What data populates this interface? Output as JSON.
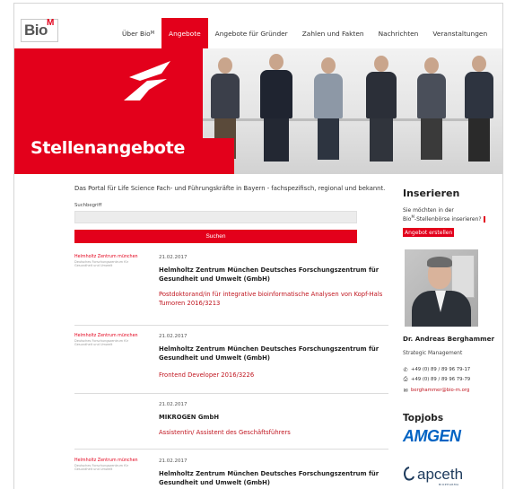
{
  "header": {
    "logo_text": "Bio",
    "logo_super": "M",
    "nav": [
      {
        "label": "Über Bio",
        "sup": "M",
        "active": false
      },
      {
        "label": "Angebote",
        "active": true
      },
      {
        "label": "Angebote für Gründer",
        "active": false
      },
      {
        "label": "Zahlen und Fakten",
        "active": false
      },
      {
        "label": "Nachrichten",
        "active": false
      },
      {
        "label": "Veranstaltungen",
        "active": false
      }
    ]
  },
  "hero": {
    "title": "Stellenangebote"
  },
  "main": {
    "intro": "Das Portal für Life Science Fach- und Führungskräfte in Bayern - fachspezifisch, regional und bekannt.",
    "search_label": "Suchbegriff",
    "search_value": "",
    "search_button": "Suchen",
    "jobs": [
      {
        "logo_name": "Helmholtz Zentrum münchen",
        "logo_sub": "Deutsches Forschungszentrum für Gesundheit und Umwelt",
        "date": "21.02.2017",
        "company": "Helmholtz Zentrum München Deutsches Forschungszentrum für Gesundheit und Umwelt (GmbH)",
        "title": "Postdoktorand/in für integrative bioinformatische Analysen von Kopf-Hals Tumoren 2016/3213"
      },
      {
        "logo_name": "Helmholtz Zentrum münchen",
        "logo_sub": "Deutsches Forschungszentrum für Gesundheit und Umwelt",
        "date": "21.02.2017",
        "company": "Helmholtz Zentrum München Deutsches Forschungszentrum für Gesundheit und Umwelt (GmbH)",
        "title": "Frontend Developer 2016/3226"
      },
      {
        "logo_name": "",
        "logo_sub": "",
        "date": "21.02.2017",
        "company": "MIKROGEN GmbH",
        "title": "Assistentin/ Assistent des Geschäftsführers"
      },
      {
        "logo_name": "Helmholtz Zentrum münchen",
        "logo_sub": "Deutsches Forschungszentrum für Gesundheit und Umwelt",
        "date": "21.02.2017",
        "company": "Helmholtz Zentrum München Deutsches Forschungszentrum für Gesundheit und Umwelt (GmbH)",
        "title": ""
      }
    ]
  },
  "sidebar": {
    "title": "Inserieren",
    "text_line1": "Sie möchten in der",
    "text_line2_pre": "Bio",
    "text_line2_sup": "M",
    "text_line2_post": "-Stellenbörse inserieren?",
    "cta": "Angebot erstellen",
    "contact_name": "Dr. Andreas Berghammer",
    "contact_role": "Strategic Management",
    "phone": "+49 (0) 89 / 89 96 79-17",
    "fax": "+49 (0) 89 / 89 96 79-79",
    "email": "berghammer@bio-m.org",
    "topjobs_title": "Topjobs",
    "sponsor1": "AMGEN",
    "sponsor2": "apceth",
    "sponsor2_sub": "BIOPHARMA"
  },
  "colors": {
    "brand_red": "#e3001b",
    "link_red": "#c0151f",
    "amgen_blue": "#0063c3",
    "apceth_navy": "#1d3a5c"
  },
  "icons": [
    "phone-icon",
    "fax-icon",
    "mail-icon"
  ]
}
